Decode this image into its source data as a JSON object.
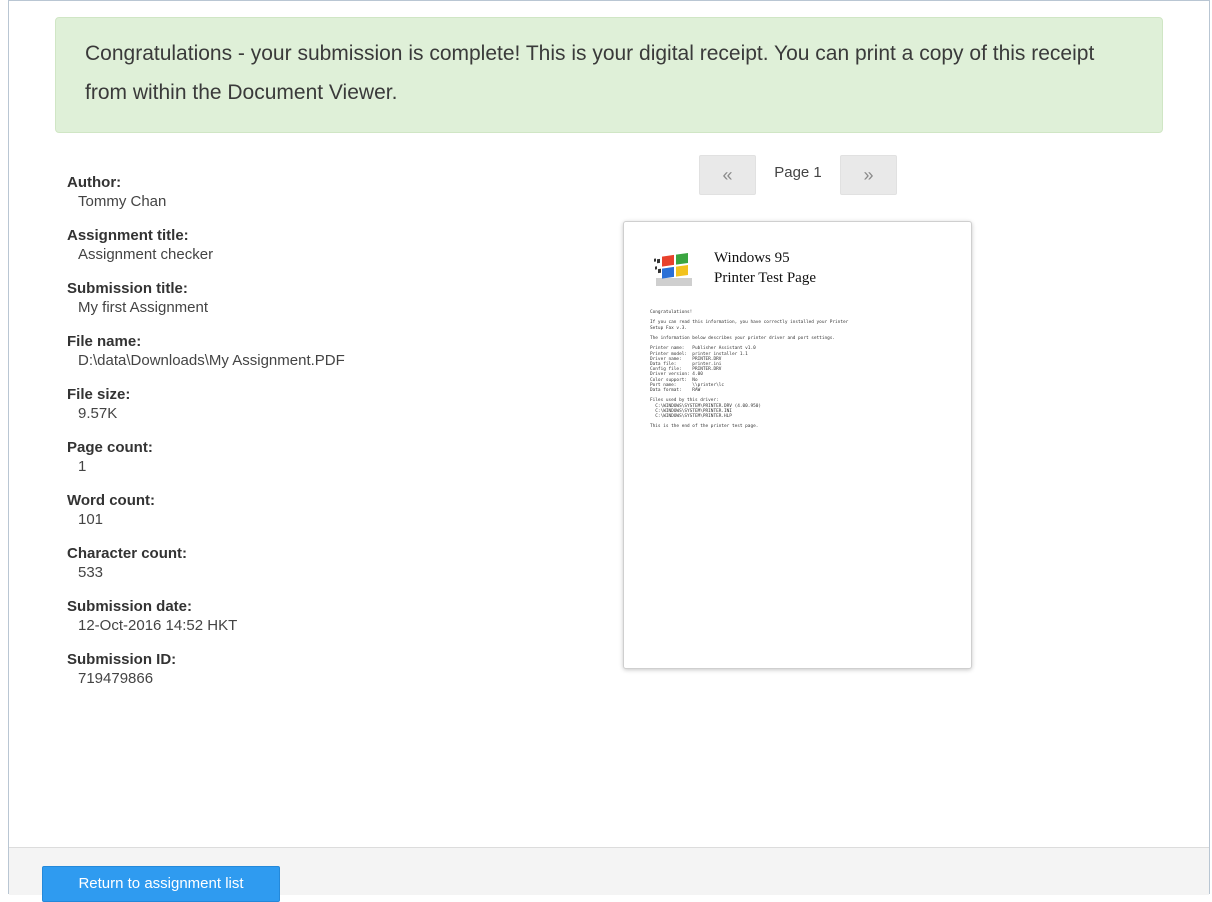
{
  "alert": {
    "message": "Congratulations - your submission is complete! This is your digital receipt. You can print a copy of this receipt from within the Document Viewer."
  },
  "colors": {
    "alert_bg": "#dff0d8",
    "primary_button": "#2f9bf0"
  },
  "receipt": {
    "fields": [
      {
        "label": "Author:",
        "value": "Tommy Chan"
      },
      {
        "label": "Assignment title:",
        "value": "Assignment checker"
      },
      {
        "label": "Submission title:",
        "value": "My first Assignment"
      },
      {
        "label": "File name:",
        "value": "D:\\data\\Downloads\\My Assignment.PDF"
      },
      {
        "label": "File size:",
        "value": "9.57K"
      },
      {
        "label": "Page count:",
        "value": "1"
      },
      {
        "label": "Word count:",
        "value": "101"
      },
      {
        "label": "Character count:",
        "value": "533"
      },
      {
        "label": "Submission date:",
        "value": "12-Oct-2016 14:52 HKT"
      },
      {
        "label": "Submission ID:",
        "value": "719479866"
      }
    ]
  },
  "viewer": {
    "prev_label": "«",
    "next_label": "»",
    "page_label": "Page 1",
    "document": {
      "logo_icon": "windows-logo-icon",
      "title": "Windows 95\nPrinter Test Page",
      "body": "Congratulations!\n\nIf you can read this information, you have correctly installed your Printer\nSetup Fax v.3.\n\nThe information below describes your printer driver and port settings.\n\nPrinter name:   Publisher Assistant v1.0\nPrinter model:  printer installer 1.1\nDriver name:    PRINTER.DRV\nData file:      printer.ini\nConfig file:    PRINTER.DRV\nDriver version: 4.00\nColor support:  No\nPort name:      \\\\printer\\lc\nData format:    RAW\n\nFiles used by this driver:\n  C:\\WINDOWS\\SYSTEM\\PRINTER.DRV (4.00.950)\n  C:\\WINDOWS\\SYSTEM\\PRINTER.INI\n  C:\\WINDOWS\\SYSTEM\\PRINTER.HLP\n\nThis is the end of the printer test page."
    }
  },
  "footer": {
    "return_label": "Return to assignment list"
  }
}
